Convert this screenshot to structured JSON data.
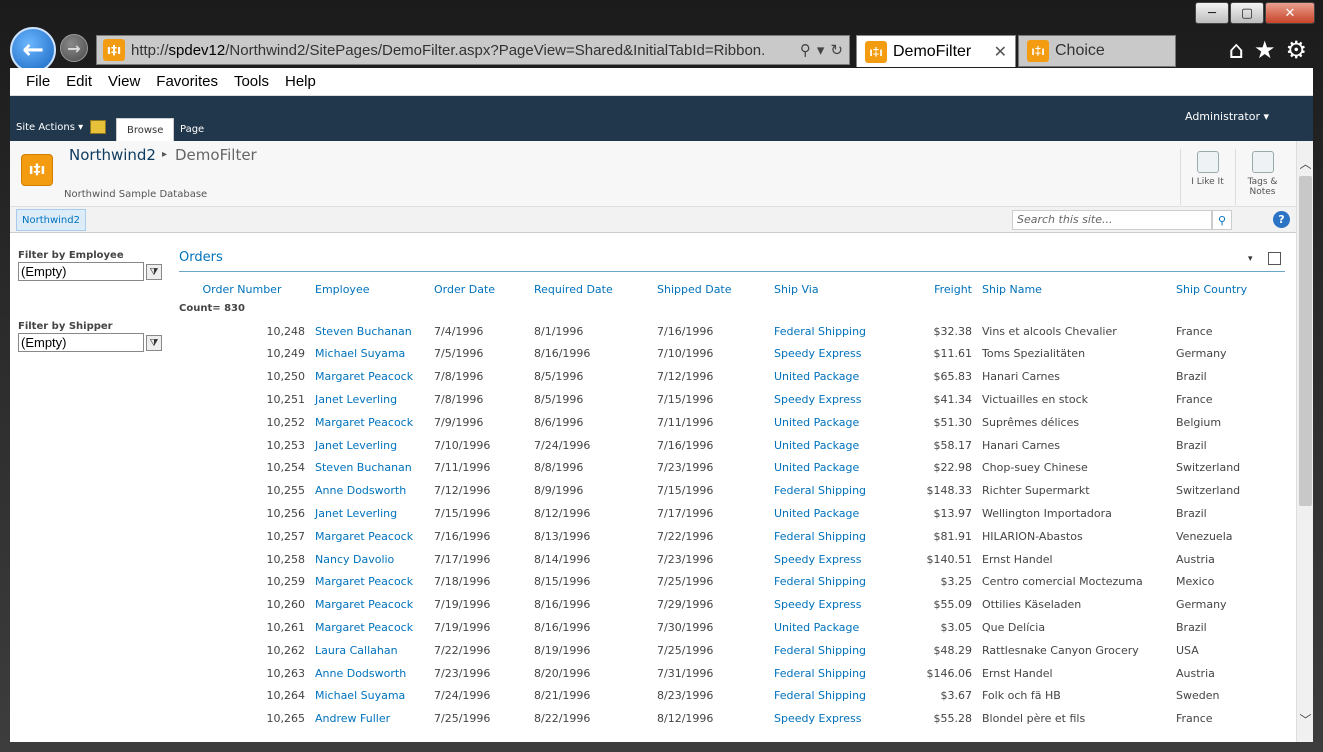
{
  "browser": {
    "url_prefix": "http://",
    "url_host": "spdev12",
    "url_path": "/Northwind2/SitePages/DemoFilter.aspx?PageView=Shared&InitialTabId=Ribbon.",
    "tabs": [
      {
        "label": "DemoFilter",
        "active": true
      },
      {
        "label": "Choice",
        "active": false
      }
    ],
    "menu": [
      "File",
      "Edit",
      "View",
      "Favorites",
      "Tools",
      "Help"
    ],
    "window_controls": [
      "─",
      "▢",
      "✕"
    ]
  },
  "ribbon": {
    "site_actions": "Site Actions ▾",
    "tabs": [
      "Browse",
      "Page"
    ],
    "user": "Administrator ▾"
  },
  "title_area": {
    "site_name": "Northwind2",
    "separator": "▸",
    "page_name": "DemoFilter",
    "description": "Northwind Sample Database",
    "like_label": "I Like It",
    "tags_label_1": "Tags &",
    "tags_label_2": "Notes"
  },
  "topnav": {
    "item": "Northwind2",
    "search_placeholder": "Search this site..."
  },
  "filters": [
    {
      "label": "Filter by Employee",
      "value": "(Empty)"
    },
    {
      "label": "Filter by Shipper",
      "value": "(Empty)"
    }
  ],
  "webpart": {
    "title": "Orders",
    "count_text": "Count= 830",
    "columns": [
      "Order Number",
      "Employee",
      "Order Date",
      "Required Date",
      "Shipped Date",
      "Ship Via",
      "Freight",
      "Ship Name",
      "Ship Country"
    ],
    "rows": [
      [
        "10,248",
        "Steven Buchanan",
        "7/4/1996",
        "8/1/1996",
        "7/16/1996",
        "Federal Shipping",
        "$32.38",
        "Vins et alcools Chevalier",
        "France"
      ],
      [
        "10,249",
        "Michael Suyama",
        "7/5/1996",
        "8/16/1996",
        "7/10/1996",
        "Speedy Express",
        "$11.61",
        "Toms Spezialitäten",
        "Germany"
      ],
      [
        "10,250",
        "Margaret Peacock",
        "7/8/1996",
        "8/5/1996",
        "7/12/1996",
        "United Package",
        "$65.83",
        "Hanari Carnes",
        "Brazil"
      ],
      [
        "10,251",
        "Janet Leverling",
        "7/8/1996",
        "8/5/1996",
        "7/15/1996",
        "Speedy Express",
        "$41.34",
        "Victuailles en stock",
        "France"
      ],
      [
        "10,252",
        "Margaret Peacock",
        "7/9/1996",
        "8/6/1996",
        "7/11/1996",
        "United Package",
        "$51.30",
        "Suprêmes délices",
        "Belgium"
      ],
      [
        "10,253",
        "Janet Leverling",
        "7/10/1996",
        "7/24/1996",
        "7/16/1996",
        "United Package",
        "$58.17",
        "Hanari Carnes",
        "Brazil"
      ],
      [
        "10,254",
        "Steven Buchanan",
        "7/11/1996",
        "8/8/1996",
        "7/23/1996",
        "United Package",
        "$22.98",
        "Chop-suey Chinese",
        "Switzerland"
      ],
      [
        "10,255",
        "Anne Dodsworth",
        "7/12/1996",
        "8/9/1996",
        "7/15/1996",
        "Federal Shipping",
        "$148.33",
        "Richter Supermarkt",
        "Switzerland"
      ],
      [
        "10,256",
        "Janet Leverling",
        "7/15/1996",
        "8/12/1996",
        "7/17/1996",
        "United Package",
        "$13.97",
        "Wellington Importadora",
        "Brazil"
      ],
      [
        "10,257",
        "Margaret Peacock",
        "7/16/1996",
        "8/13/1996",
        "7/22/1996",
        "Federal Shipping",
        "$81.91",
        "HILARION-Abastos",
        "Venezuela"
      ],
      [
        "10,258",
        "Nancy Davolio",
        "7/17/1996",
        "8/14/1996",
        "7/23/1996",
        "Speedy Express",
        "$140.51",
        "Ernst Handel",
        "Austria"
      ],
      [
        "10,259",
        "Margaret Peacock",
        "7/18/1996",
        "8/15/1996",
        "7/25/1996",
        "Federal Shipping",
        "$3.25",
        "Centro comercial Moctezuma",
        "Mexico"
      ],
      [
        "10,260",
        "Margaret Peacock",
        "7/19/1996",
        "8/16/1996",
        "7/29/1996",
        "Speedy Express",
        "$55.09",
        "Ottilies Käseladen",
        "Germany"
      ],
      [
        "10,261",
        "Margaret Peacock",
        "7/19/1996",
        "8/16/1996",
        "7/30/1996",
        "United Package",
        "$3.05",
        "Que Delícia",
        "Brazil"
      ],
      [
        "10,262",
        "Laura Callahan",
        "7/22/1996",
        "8/19/1996",
        "7/25/1996",
        "Federal Shipping",
        "$48.29",
        "Rattlesnake Canyon Grocery",
        "USA"
      ],
      [
        "10,263",
        "Anne Dodsworth",
        "7/23/1996",
        "8/20/1996",
        "7/31/1996",
        "Federal Shipping",
        "$146.06",
        "Ernst Handel",
        "Austria"
      ],
      [
        "10,264",
        "Michael Suyama",
        "7/24/1996",
        "8/21/1996",
        "8/23/1996",
        "Federal Shipping",
        "$3.67",
        "Folk och fä HB",
        "Sweden"
      ],
      [
        "10,265",
        "Andrew Fuller",
        "7/25/1996",
        "8/22/1996",
        "8/12/1996",
        "Speedy Express",
        "$55.28",
        "Blondel père et fils",
        "France"
      ]
    ]
  },
  "colors": {
    "ribbon": "#21374c",
    "link": "#0072bc",
    "favicon": "#f39c12"
  }
}
